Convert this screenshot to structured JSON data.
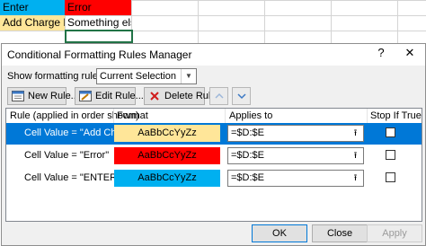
{
  "sheet": {
    "cells": {
      "d1": "Enter",
      "e1": "Error",
      "d2": "Add Charge No",
      "e2": "Something else"
    },
    "colors": {
      "enter_fill": "#00b0f0",
      "error_fill": "#ff0000",
      "add_charge_fill": "#ffe699"
    }
  },
  "dialog": {
    "title": "Conditional Formatting Rules Manager",
    "help_glyph": "?",
    "close_glyph": "✕",
    "show_rules_label_prefix": "Show formatting rules for:",
    "show_rules_value": "Current Selection",
    "toolbar": {
      "new_rule": "New Rule...",
      "edit_rule": "Edit Rule...",
      "delete_rule": "Delete Rule"
    },
    "columns": {
      "rule": "Rule (applied in order shown)",
      "format": "Format",
      "applies_to": "Applies to",
      "stop_if_true": "Stop If True"
    },
    "rules": [
      {
        "rule": "Cell Value = \"Add Char...",
        "preview": "AaBbCcYyZz",
        "fill": "#ffe699",
        "applies_to": "=$D:$E",
        "stop_if_true": false,
        "selected": true
      },
      {
        "rule": "Cell Value = \"Error\"",
        "preview": "AaBbCcYyZz",
        "fill": "#ff0000",
        "applies_to": "=$D:$E",
        "stop_if_true": false,
        "selected": false
      },
      {
        "rule": "Cell Value = \"ENTER\"",
        "preview": "AaBbCcYyZz",
        "fill": "#00b0f0",
        "applies_to": "=$D:$E",
        "stop_if_true": false,
        "selected": false
      }
    ],
    "buttons": {
      "ok": "OK",
      "close": "Close",
      "apply": "Apply"
    },
    "accent": "#0078d7"
  }
}
